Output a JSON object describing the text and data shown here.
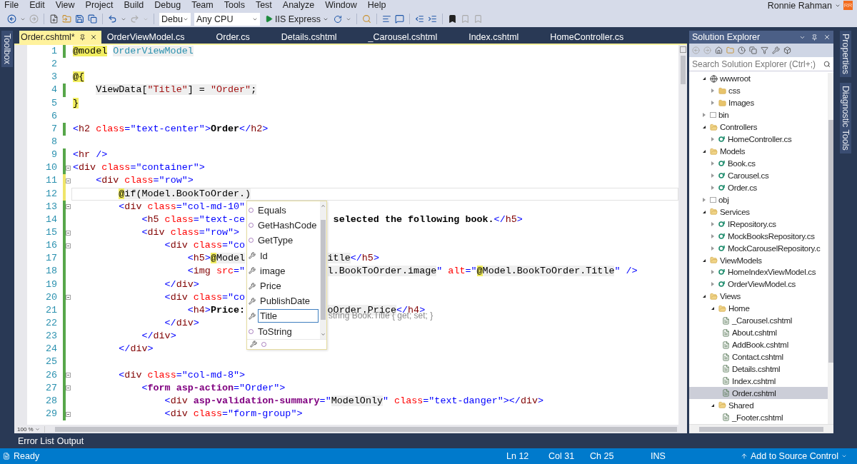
{
  "menu": [
    "File",
    "Edit",
    "View",
    "Project",
    "Build",
    "Debug",
    "Team",
    "Tools",
    "Test",
    "Analyze",
    "Window",
    "Help"
  ],
  "account": {
    "name": "Ronnie Rahman",
    "initials": "RR"
  },
  "toolbar": {
    "configuration": "Debu",
    "platform": "Any CPU",
    "run_target": "IIS Express"
  },
  "left_strip": [
    "Toolbox"
  ],
  "document_tabs": [
    {
      "label": "Order.cshtml*",
      "selected": true
    },
    {
      "label": "OrderViewModel.cs",
      "selected": false
    },
    {
      "label": "Order.cs",
      "selected": false
    },
    {
      "label": "Details.cshtml",
      "selected": false
    },
    {
      "label": "_Carousel.cshtml",
      "selected": false
    },
    {
      "label": "Index.cshtml",
      "selected": false
    },
    {
      "label": "HomeController.cs",
      "selected": false
    }
  ],
  "editor": {
    "lines": [
      {
        "number": "1",
        "modified": true,
        "saved": true,
        "foldable": false,
        "current": false,
        "tokens": [
          {
            "kind": "razor",
            "text": "@model"
          },
          {
            "kind": "type",
            "text": " OrderViewModel"
          }
        ]
      },
      {
        "number": "2",
        "modified": false,
        "foldable": false,
        "current": false
      },
      {
        "number": "3",
        "modified": false,
        "foldable": false,
        "current": false,
        "tokens": [
          {
            "kind": "razor",
            "text": "@{"
          }
        ]
      },
      {
        "number": "4",
        "modified": true,
        "saved": true,
        "foldable": false,
        "current": false,
        "tokens": [
          {
            "kind": "cs",
            "text": "    ViewData["
          },
          {
            "kind": "csstr",
            "text": "\"Title\""
          },
          {
            "kind": "cs",
            "text": "] = "
          },
          {
            "kind": "csstr",
            "text": "\"Order\""
          },
          {
            "kind": "cs",
            "text": ";"
          }
        ]
      },
      {
        "number": "5",
        "modified": false,
        "foldable": false,
        "current": false,
        "tokens": [
          {
            "kind": "razor",
            "text": "}"
          }
        ]
      },
      {
        "number": "6",
        "modified": false,
        "foldable": false,
        "current": false
      },
      {
        "number": "7",
        "modified": true,
        "saved": true,
        "foldable": false,
        "current": false,
        "tokens": [
          {
            "kind": "punct",
            "text": "<"
          },
          {
            "kind": "tag",
            "text": "h2"
          },
          {
            "kind": "attr",
            "text": " class"
          },
          {
            "kind": "punct",
            "text": "="
          },
          {
            "kind": "val",
            "text": "\"text-center\""
          },
          {
            "kind": "punct",
            "text": ">"
          },
          {
            "kind": "bold",
            "text": "Order"
          },
          {
            "kind": "punct",
            "text": "</"
          },
          {
            "kind": "tag",
            "text": "h2"
          },
          {
            "kind": "punct",
            "text": ">"
          }
        ]
      },
      {
        "number": "8",
        "modified": false,
        "foldable": false,
        "current": false
      },
      {
        "number": "9",
        "modified": true,
        "saved": true,
        "foldable": false,
        "current": false,
        "tokens": [
          {
            "kind": "punct",
            "text": "<"
          },
          {
            "kind": "tag",
            "text": "hr"
          },
          {
            "kind": "punct",
            "text": " />"
          }
        ]
      },
      {
        "number": "10",
        "modified": true,
        "saved": true,
        "foldable": true,
        "current": false,
        "tokens": [
          {
            "kind": "punct",
            "text": "<"
          },
          {
            "kind": "tag",
            "text": "div"
          },
          {
            "kind": "attr",
            "text": " class"
          },
          {
            "kind": "punct",
            "text": "="
          },
          {
            "kind": "val",
            "text": "\"container\""
          },
          {
            "kind": "punct",
            "text": ">"
          }
        ]
      },
      {
        "number": "11",
        "modified": true,
        "saved": false,
        "foldable": true,
        "current": false,
        "tokens": [
          {
            "kind": "punct",
            "text": "    <"
          },
          {
            "kind": "tag",
            "text": "div"
          },
          {
            "kind": "attr",
            "text": " class"
          },
          {
            "kind": "punct",
            "text": "="
          },
          {
            "kind": "val",
            "text": "\"row\""
          },
          {
            "kind": "punct",
            "text": ">"
          }
        ]
      },
      {
        "number": "12",
        "modified": true,
        "saved": false,
        "foldable": false,
        "current": true,
        "tokens": [
          {
            "kind": "razor",
            "text": "        @"
          },
          {
            "kind": "cs",
            "text": "if(Model.BookToOrder.)"
          }
        ]
      },
      {
        "number": "13",
        "modified": true,
        "saved": true,
        "foldable": true,
        "current": false,
        "tokens": [
          {
            "kind": "punct",
            "text": "        <"
          },
          {
            "kind": "tag",
            "text": "div"
          },
          {
            "kind": "attr",
            "text": " class"
          },
          {
            "kind": "punct",
            "text": "="
          },
          {
            "kind": "val",
            "text": "\"col-md-10\""
          }
        ]
      },
      {
        "number": "14",
        "modified": true,
        "saved": true,
        "foldable": false,
        "current": false,
        "tokens": [
          {
            "kind": "punct",
            "text": "            <"
          },
          {
            "kind": "tag",
            "text": "h5"
          },
          {
            "kind": "attr",
            "text": " class"
          },
          {
            "kind": "punct",
            "text": "="
          },
          {
            "kind": "val",
            "text": "\"text-ce"
          }
        ],
        "after": [
          {
            "kind": "bold",
            "text": " selected the following book."
          },
          {
            "kind": "punct",
            "text": "</"
          },
          {
            "kind": "tag",
            "text": "h5"
          },
          {
            "kind": "punct",
            "text": ">"
          }
        ]
      },
      {
        "number": "15",
        "modified": true,
        "saved": true,
        "foldable": true,
        "current": false,
        "tokens": [
          {
            "kind": "punct",
            "text": "            <"
          },
          {
            "kind": "tag",
            "text": "div"
          },
          {
            "kind": "attr",
            "text": " class"
          },
          {
            "kind": "punct",
            "text": "="
          },
          {
            "kind": "val",
            "text": "\"row\""
          },
          {
            "kind": "punct",
            "text": ">"
          }
        ]
      },
      {
        "number": "16",
        "modified": true,
        "saved": true,
        "foldable": true,
        "current": false,
        "tokens": [
          {
            "kind": "punct",
            "text": "                <"
          },
          {
            "kind": "tag",
            "text": "div"
          },
          {
            "kind": "attr",
            "text": " class"
          },
          {
            "kind": "punct",
            "text": "="
          },
          {
            "kind": "val",
            "text": "\"co"
          }
        ]
      },
      {
        "number": "17",
        "modified": true,
        "saved": true,
        "foldable": false,
        "current": false,
        "tokens": [
          {
            "kind": "punct",
            "text": "                    <"
          },
          {
            "kind": "tag",
            "text": "h5"
          },
          {
            "kind": "punct",
            "text": ">"
          },
          {
            "kind": "razor",
            "text": "@"
          },
          {
            "kind": "cs",
            "text": "Model"
          }
        ],
        "after": [
          {
            "kind": "cs",
            "text": "itle"
          },
          {
            "kind": "punct",
            "text": "</"
          },
          {
            "kind": "tag",
            "text": "h5"
          },
          {
            "kind": "punct",
            "text": ">"
          }
        ]
      },
      {
        "number": "18",
        "modified": true,
        "saved": true,
        "foldable": false,
        "current": false,
        "tokens": [
          {
            "kind": "punct",
            "text": "                    <"
          },
          {
            "kind": "tag",
            "text": "img"
          },
          {
            "kind": "attr",
            "text": " src"
          },
          {
            "kind": "punct",
            "text": "="
          },
          {
            "kind": "val",
            "text": "\""
          }
        ],
        "after": [
          {
            "kind": "cs",
            "text": "l.BookToOrder.image"
          },
          {
            "kind": "val",
            "text": "\""
          },
          {
            "kind": "attr",
            "text": " alt"
          },
          {
            "kind": "punct",
            "text": "="
          },
          {
            "kind": "val",
            "text": "\""
          },
          {
            "kind": "razor",
            "text": "@"
          },
          {
            "kind": "cs",
            "text": "Model.BookToOrder.Title"
          },
          {
            "kind": "val",
            "text": "\""
          },
          {
            "kind": "punct",
            "text": " />"
          }
        ]
      },
      {
        "number": "19",
        "modified": true,
        "saved": true,
        "foldable": false,
        "current": false,
        "tokens": [
          {
            "kind": "punct",
            "text": "                </"
          },
          {
            "kind": "tag",
            "text": "div"
          },
          {
            "kind": "punct",
            "text": ">"
          }
        ]
      },
      {
        "number": "20",
        "modified": true,
        "saved": true,
        "foldable": true,
        "current": false,
        "tokens": [
          {
            "kind": "punct",
            "text": "                <"
          },
          {
            "kind": "tag",
            "text": "div"
          },
          {
            "kind": "attr",
            "text": " class"
          },
          {
            "kind": "punct",
            "text": "="
          },
          {
            "kind": "val",
            "text": "\"co"
          }
        ]
      },
      {
        "number": "21",
        "modified": true,
        "saved": true,
        "foldable": false,
        "current": false,
        "tokens": [
          {
            "kind": "punct",
            "text": "                    <"
          },
          {
            "kind": "tag",
            "text": "h4"
          },
          {
            "kind": "punct",
            "text": ">"
          },
          {
            "kind": "bold",
            "text": "Price:"
          }
        ],
        "after": [
          {
            "kind": "cs",
            "text": "oOrder.Price"
          },
          {
            "kind": "punct",
            "text": "</"
          },
          {
            "kind": "tag",
            "text": "h4"
          },
          {
            "kind": "punct",
            "text": ">"
          }
        ]
      },
      {
        "number": "22",
        "modified": true,
        "saved": true,
        "foldable": false,
        "current": false,
        "tokens": [
          {
            "kind": "punct",
            "text": "                </"
          },
          {
            "kind": "tag",
            "text": "div"
          },
          {
            "kind": "punct",
            "text": ">"
          }
        ]
      },
      {
        "number": "23",
        "modified": true,
        "saved": true,
        "foldable": false,
        "current": false,
        "tokens": [
          {
            "kind": "punct",
            "text": "            </"
          },
          {
            "kind": "tag",
            "text": "div"
          },
          {
            "kind": "punct",
            "text": ">"
          }
        ]
      },
      {
        "number": "24",
        "modified": true,
        "saved": true,
        "foldable": false,
        "current": false,
        "tokens": [
          {
            "kind": "punct",
            "text": "        </"
          },
          {
            "kind": "tag",
            "text": "div"
          },
          {
            "kind": "punct",
            "text": ">"
          }
        ]
      },
      {
        "number": "25",
        "modified": true,
        "saved": true,
        "foldable": false,
        "current": false
      },
      {
        "number": "26",
        "modified": true,
        "saved": true,
        "foldable": true,
        "current": false,
        "tokens": [
          {
            "kind": "punct",
            "text": "        <"
          },
          {
            "kind": "tag",
            "text": "div"
          },
          {
            "kind": "attr",
            "text": " class"
          },
          {
            "kind": "punct",
            "text": "="
          },
          {
            "kind": "val",
            "text": "\"col-md-8\""
          },
          {
            "kind": "punct",
            "text": ">"
          }
        ]
      },
      {
        "number": "27",
        "modified": true,
        "saved": true,
        "foldable": true,
        "current": false,
        "tokens": [
          {
            "kind": "punct",
            "text": "            <"
          },
          {
            "kind": "helper",
            "text": "form"
          },
          {
            "kind": "helper",
            "text": " asp-action"
          },
          {
            "kind": "punct",
            "text": "="
          },
          {
            "kind": "val",
            "text": "\"Order\""
          },
          {
            "kind": "punct",
            "text": ">"
          }
        ]
      },
      {
        "number": "28",
        "modified": true,
        "saved": true,
        "foldable": false,
        "current": false,
        "tokens": [
          {
            "kind": "punct",
            "text": "                <"
          },
          {
            "kind": "tag",
            "text": "div"
          },
          {
            "kind": "helper",
            "text": " asp-validation-summary"
          },
          {
            "kind": "punct",
            "text": "="
          },
          {
            "kind": "val",
            "text": "\""
          },
          {
            "kind": "cs",
            "text": "ModelOnly"
          },
          {
            "kind": "val",
            "text": "\""
          },
          {
            "kind": "attr",
            "text": " class"
          },
          {
            "kind": "punct",
            "text": "="
          },
          {
            "kind": "val",
            "text": "\"text-danger\""
          },
          {
            "kind": "punct",
            "text": "></"
          },
          {
            "kind": "tag",
            "text": "div"
          },
          {
            "kind": "punct",
            "text": ">"
          }
        ]
      },
      {
        "number": "29",
        "modified": true,
        "saved": true,
        "foldable": true,
        "current": false,
        "tokens": [
          {
            "kind": "punct",
            "text": "                <"
          },
          {
            "kind": "tag",
            "text": "div"
          },
          {
            "kind": "attr",
            "text": " class"
          },
          {
            "kind": "punct",
            "text": "="
          },
          {
            "kind": "val",
            "text": "\"form-group\""
          },
          {
            "kind": "punct",
            "text": ">"
          }
        ]
      }
    ],
    "completion": {
      "items": [
        {
          "label": "Equals",
          "kind": "method",
          "selected": false
        },
        {
          "label": "GetHashCode",
          "kind": "method",
          "selected": false
        },
        {
          "label": "GetType",
          "kind": "method",
          "selected": false
        },
        {
          "label": "Id",
          "kind": "property",
          "selected": false
        },
        {
          "label": "image",
          "kind": "property",
          "selected": false
        },
        {
          "label": "Price",
          "kind": "property",
          "selected": false
        },
        {
          "label": "PublishDate",
          "kind": "property",
          "selected": false
        },
        {
          "label": "Title",
          "kind": "property",
          "selected": true
        },
        {
          "label": "ToString",
          "kind": "method",
          "selected": false
        }
      ]
    },
    "quick_info": "string Book.Title { get; set; }",
    "zoom": "100 %"
  },
  "solution_explorer": {
    "title": "Solution Explorer",
    "search_placeholder": "Search Solution Explorer (Ctrl+;)",
    "tree": [
      {
        "label": "wwwroot",
        "kind": "web",
        "expanded": true,
        "selected": false,
        "children": [
          {
            "label": "css",
            "kind": "folder",
            "expanded": false,
            "selected": false
          },
          {
            "label": "Images",
            "kind": "folder",
            "expanded": false,
            "selected": false
          }
        ]
      },
      {
        "label": "bin",
        "kind": "dir",
        "expanded": false,
        "selected": false
      },
      {
        "label": "Controllers",
        "kind": "folder",
        "expanded": true,
        "selected": false,
        "children": [
          {
            "label": "HomeController.cs",
            "kind": "cs",
            "expanded": false,
            "selected": false
          }
        ]
      },
      {
        "label": "Models",
        "kind": "folder",
        "expanded": true,
        "selected": false,
        "children": [
          {
            "label": "Book.cs",
            "kind": "cs",
            "expanded": false,
            "selected": false
          },
          {
            "label": "Carousel.cs",
            "kind": "cs",
            "expanded": false,
            "selected": false
          },
          {
            "label": "Order.cs",
            "kind": "cs",
            "expanded": false,
            "selected": false
          }
        ]
      },
      {
        "label": "obj",
        "kind": "dir",
        "expanded": false,
        "selected": false
      },
      {
        "label": "Services",
        "kind": "folder",
        "expanded": true,
        "selected": false,
        "children": [
          {
            "label": "IRepository.cs",
            "kind": "cs",
            "expanded": false,
            "selected": false
          },
          {
            "label": "MockBooksRepository.cs",
            "kind": "cs",
            "expanded": false,
            "selected": false
          },
          {
            "label": "MockCarouselRepository.c",
            "kind": "cs",
            "expanded": false,
            "selected": false
          }
        ]
      },
      {
        "label": "ViewModels",
        "kind": "folder",
        "expanded": true,
        "selected": false,
        "children": [
          {
            "label": "HomeIndexViewModel.cs",
            "kind": "cs",
            "expanded": false,
            "selected": false
          },
          {
            "label": "OrderViewModel.cs",
            "kind": "cs",
            "expanded": false,
            "selected": false
          }
        ]
      },
      {
        "label": "Views",
        "kind": "folder",
        "expanded": true,
        "selected": false,
        "children": [
          {
            "label": "Home",
            "kind": "folder",
            "expanded": true,
            "selected": false,
            "children": [
              {
                "label": "_Carousel.cshtml",
                "kind": "page",
                "selected": false
              },
              {
                "label": "About.cshtml",
                "kind": "page",
                "selected": false
              },
              {
                "label": "AddBook.cshtml",
                "kind": "page",
                "selected": false
              },
              {
                "label": "Contact.cshtml",
                "kind": "page",
                "selected": false
              },
              {
                "label": "Details.cshtml",
                "kind": "page",
                "selected": false
              },
              {
                "label": "Index.cshtml",
                "kind": "page",
                "selected": false
              },
              {
                "label": "Order.cshtml",
                "kind": "page",
                "selected": true
              }
            ]
          },
          {
            "label": "Shared",
            "kind": "folder",
            "expanded": true,
            "selected": false,
            "children": [
              {
                "label": "_Footer.cshtml",
                "kind": "page",
                "selected": false
              }
            ]
          }
        ]
      }
    ]
  },
  "right_strip": [
    "Properties",
    "Diagnostic Tools"
  ],
  "bottom_tabs": [
    "Error List",
    "Output"
  ],
  "status_bar": {
    "message": "Ready",
    "line": "Ln 12",
    "column": "Col 31",
    "character": "Ch 25",
    "mode": "INS",
    "source_control": "Add to Source Control"
  }
}
